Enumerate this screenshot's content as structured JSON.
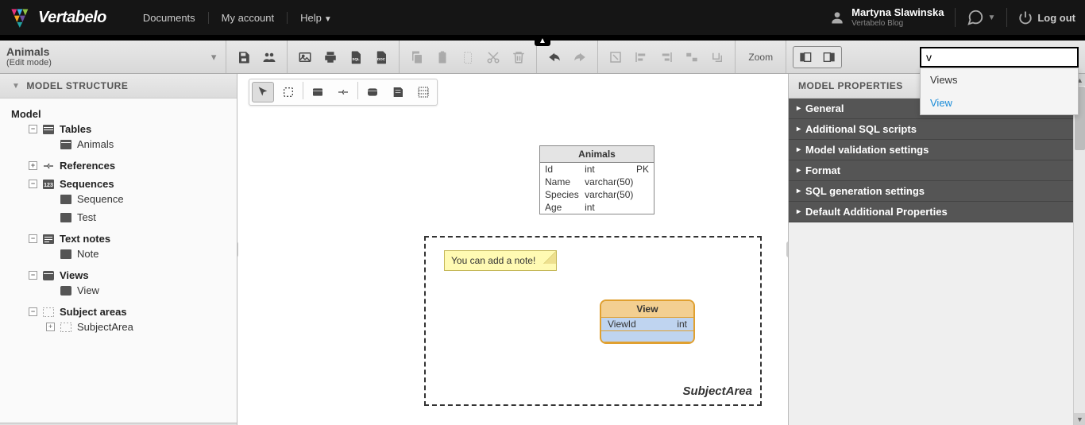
{
  "header": {
    "brand": "Vertabelo",
    "nav": {
      "documents": "Documents",
      "account": "My account",
      "help": "Help"
    },
    "user": {
      "name": "Martyna Slawinska",
      "org": "Vertabelo Blog"
    },
    "logout": "Log out"
  },
  "toolbar": {
    "doc_name": "Animals",
    "doc_mode": "(Edit mode)",
    "zoom_label": "Zoom"
  },
  "search": {
    "value": "v",
    "dropdown": {
      "item0": "Views",
      "item1": "View"
    }
  },
  "left_panel": {
    "title": "MODEL STRUCTURE",
    "root": "Model",
    "tables": "Tables",
    "tables_item0": "Animals",
    "references": "References",
    "sequences": "Sequences",
    "sequences_item0": "Sequence",
    "sequences_item1": "Test",
    "text_notes": "Text notes",
    "text_notes_item0": "Note",
    "views": "Views",
    "views_item0": "View",
    "subject_areas": "Subject areas",
    "subject_areas_item0": "SubjectArea"
  },
  "right_panel": {
    "title": "MODEL PROPERTIES",
    "sections": {
      "general": "General",
      "sql": "Additional SQL scripts",
      "validation": "Model validation settings",
      "format": "Format",
      "generation": "SQL generation settings",
      "defaults": "Default Additional Properties"
    }
  },
  "canvas": {
    "table": {
      "name": "Animals",
      "col0_name": "Id",
      "col0_type": "int",
      "col0_key": "PK",
      "col1_name": "Name",
      "col1_type": "varchar(50)",
      "col2_name": "Species",
      "col2_type": "varchar(50)",
      "col3_name": "Age",
      "col3_type": "int"
    },
    "note_text": "You can add a note!",
    "view": {
      "name": "View",
      "col0_name": "ViewId",
      "col0_type": "int"
    },
    "subject_area_label": "SubjectArea"
  }
}
